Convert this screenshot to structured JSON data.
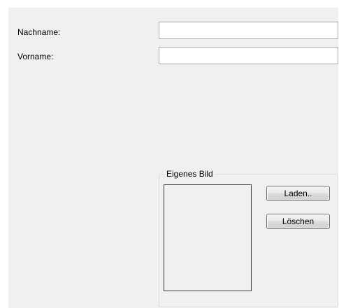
{
  "form": {
    "lastname_label": "Nachname:",
    "lastname_value": "",
    "firstname_label": "Vorname:",
    "firstname_value": ""
  },
  "picture_group": {
    "title": "Eigenes Bild",
    "load_button": "Laden..",
    "delete_button": "Löschen"
  },
  "colors": {
    "panel_background": "#f0f0f0",
    "page_background": "#ffffff",
    "input_border": "#abadb3",
    "button_border": "#707070"
  }
}
